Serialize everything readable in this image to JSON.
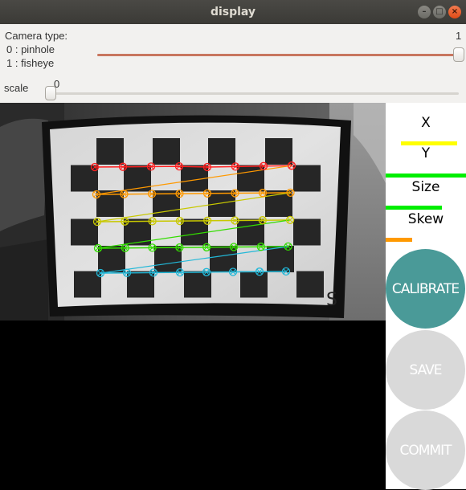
{
  "window": {
    "title": "display",
    "minimize_symbol": "–",
    "maximize_symbol": "□",
    "close_symbol": "×"
  },
  "controls": {
    "camera_type_label": "Camera type:",
    "camera_type_option0": "0 : pinhole",
    "camera_type_option1": "1 : fisheye",
    "camera_type_value": "1",
    "camera_type_level": 1.0,
    "scale_label": "scale",
    "scale_value": "0",
    "scale_level": 0.0
  },
  "panel": {
    "x_label": "X",
    "y_label": "Y",
    "size_label": "Size",
    "skew_label": "Skew",
    "x_level": 0.7,
    "y_level": 1.0,
    "size_level": 0.7,
    "skew_level": 0.33,
    "x_color": "#ffff00",
    "y_color": "#00ee00",
    "size_color": "#00ee00",
    "skew_color": "#ff9900",
    "calibrate_label": "CALIBRATE",
    "save_label": "SAVE",
    "commit_label": "COMMIT",
    "calibrate_color": "#4a9a98",
    "disabled_color": "#d9d9d9"
  },
  "camera": {
    "board_label": "S",
    "corner_rows": [
      {
        "name": "row-1",
        "color": "#ff2020"
      },
      {
        "name": "row-2",
        "color": "#ff9900"
      },
      {
        "name": "row-3",
        "color": "#c8c800"
      },
      {
        "name": "row-4",
        "color": "#33dd00"
      },
      {
        "name": "row-5",
        "color": "#22b8d8"
      }
    ]
  }
}
